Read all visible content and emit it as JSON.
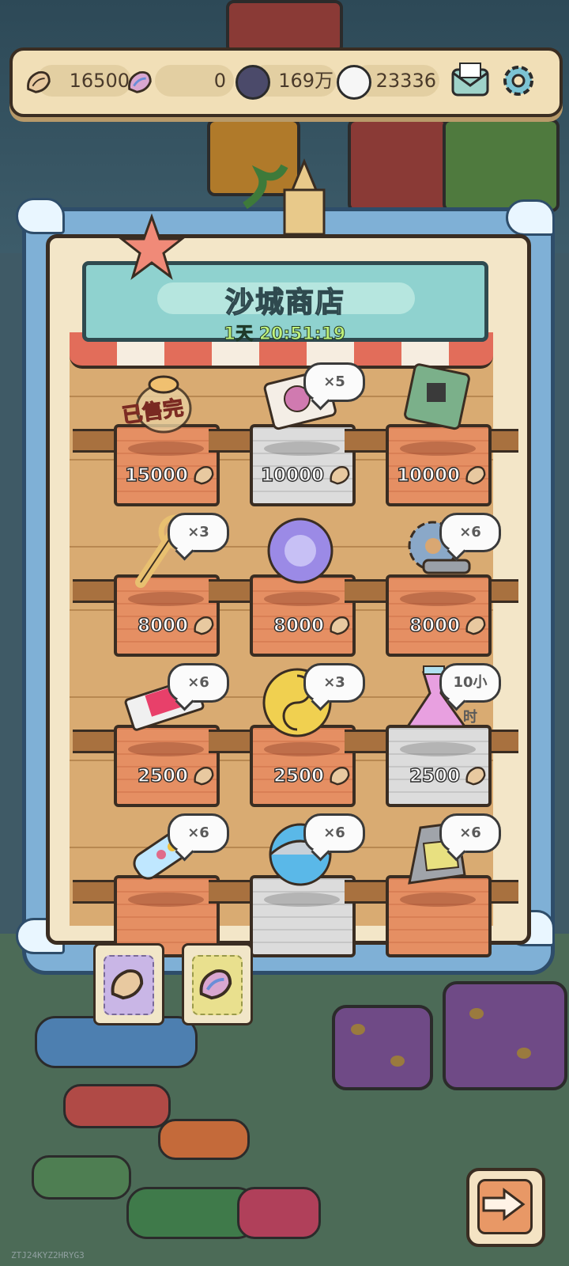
{
  "resources": {
    "shell_a": "16500",
    "shell_b": "0",
    "orb": "169万",
    "ghost": "23336"
  },
  "shop": {
    "title": "沙城商店",
    "timer": "1天 20:51:19",
    "sold_out_label": "已售完"
  },
  "items": [
    {
      "price": "15000",
      "badge": "",
      "sold_out": true,
      "crate": "orange",
      "icon": "treasure-bag-icon"
    },
    {
      "price": "10000",
      "badge": "×5",
      "sold_out": false,
      "crate": "gray",
      "icon": "map-scroll-icon"
    },
    {
      "price": "10000",
      "badge": "",
      "sold_out": false,
      "crate": "orange",
      "icon": "circuit-board-icon"
    },
    {
      "price": "8000",
      "badge": "×3",
      "sold_out": false,
      "crate": "orange",
      "icon": "scepter-icon"
    },
    {
      "price": "8000",
      "badge": "",
      "sold_out": false,
      "crate": "orange",
      "icon": "spirit-orb-icon"
    },
    {
      "price": "8000",
      "badge": "×6",
      "sold_out": false,
      "crate": "orange",
      "icon": "gear-screw-icon"
    },
    {
      "price": "2500",
      "badge": "×6",
      "sold_out": false,
      "crate": "orange",
      "icon": "ticket-icon"
    },
    {
      "price": "2500",
      "badge": "×3",
      "sold_out": false,
      "crate": "orange",
      "icon": "yin-yang-coin-icon"
    },
    {
      "price": "2500",
      "badge": "10小时",
      "sold_out": false,
      "crate": "gray",
      "icon": "potion-flask-icon"
    },
    {
      "price": "",
      "badge": "×6",
      "sold_out": false,
      "crate": "orange",
      "icon": "capsule-tube-icon"
    },
    {
      "price": "",
      "badge": "×6",
      "sold_out": false,
      "crate": "gray",
      "icon": "water-orb-icon"
    },
    {
      "price": "",
      "badge": "×6",
      "sold_out": false,
      "crate": "orange",
      "icon": "robot-arm-icon"
    }
  ],
  "tabs": [
    {
      "icon": "purple-shell-icon",
      "selected": true
    },
    {
      "icon": "rainbow-shell-icon",
      "selected": false
    }
  ],
  "watermark": "ZTJ24KYZ2HRYG3",
  "colors": {
    "accent": "#8fd2cf",
    "crate": "#e58f63",
    "timer": "#bff07a"
  }
}
